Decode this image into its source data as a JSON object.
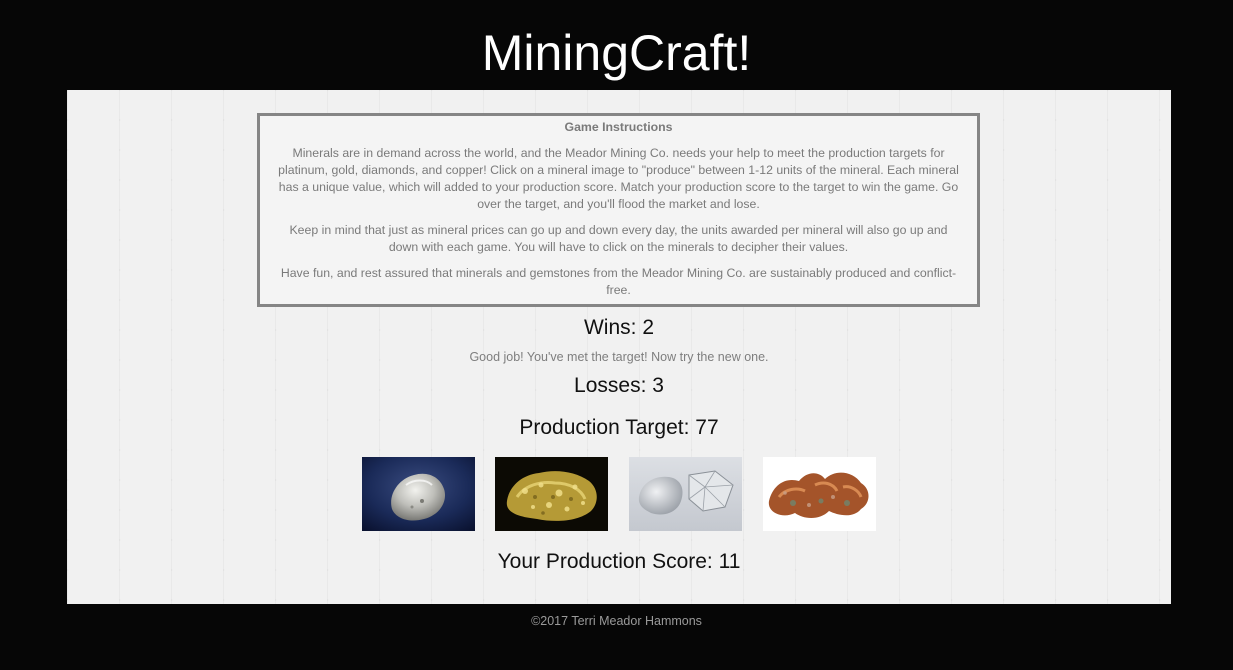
{
  "header": {
    "title": "MiningCraft!"
  },
  "instructions": {
    "title": "Game Instructions",
    "paragraphs": [
      "Minerals are in demand across the world, and the Meador Mining Co. needs your help to meet the production targets for platinum, gold, diamonds, and copper! Click on a mineral image to \"produce\" between 1-12 units of the mineral. Each mineral has a unique value, which will added to your production score. Match your production score to the target to win the game. Go over the target, and you'll flood the market and lose.",
      "Keep in mind that just as mineral prices can go up and down every day, the units awarded per mineral will also go up and down with each game. You will have to click on the minerals to decipher their values.",
      "Have fun, and rest assured that minerals and gemstones from the Meador Mining Co. are sustainably produced and conflict-free."
    ]
  },
  "stats": {
    "wins": "Wins: 2",
    "message": "Good job! You've met the target! Now try the new one.",
    "losses": "Losses: 3",
    "target": "Production Target: 77",
    "score": "Your Production Score: 11"
  },
  "minerals": [
    {
      "name": "platinum",
      "icon": "platinum-nugget-image"
    },
    {
      "name": "gold",
      "icon": "gold-nugget-image"
    },
    {
      "name": "diamond",
      "icon": "diamond-image"
    },
    {
      "name": "copper",
      "icon": "copper-nugget-image"
    }
  ],
  "footer": {
    "text": "©2017 Terri Meador Hammons"
  },
  "colors": {
    "page_background": "#060606",
    "panel_background": "#f1f1f1",
    "instructions_border": "#858585",
    "title_text": "#ffffff"
  }
}
